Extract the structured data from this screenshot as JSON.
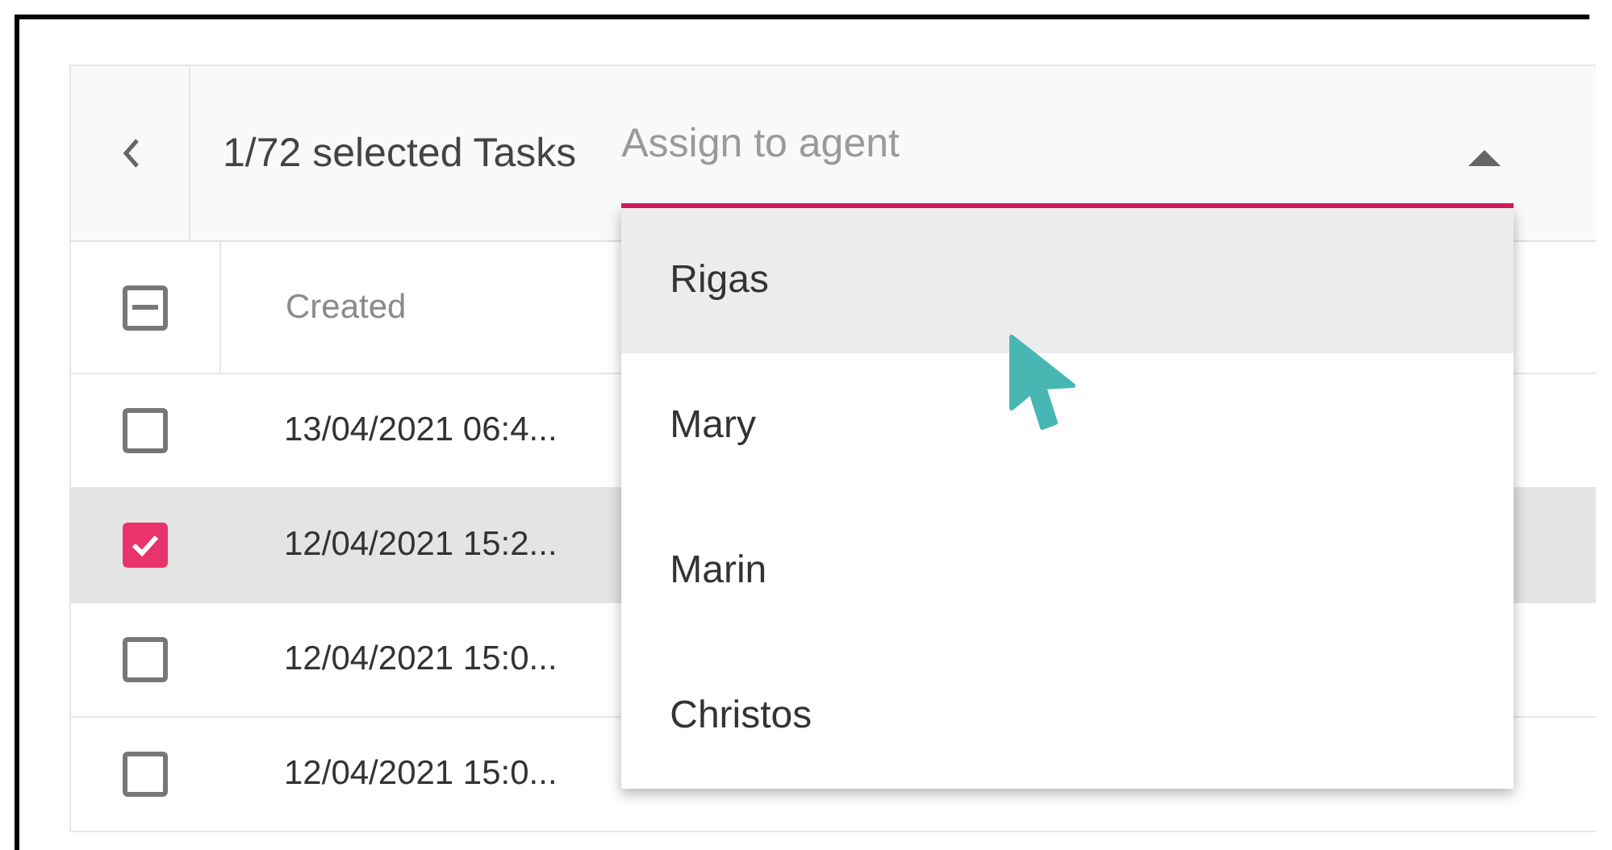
{
  "header": {
    "selection_text": "1/72 selected Tasks",
    "assign_field": {
      "placeholder": "Assign to agent",
      "expanded": true
    }
  },
  "table": {
    "select_all": {
      "indeterminate": true
    },
    "columns": [
      "Created"
    ],
    "rows": [
      {
        "created": "13/04/2021 06:4...",
        "selected": false
      },
      {
        "created": "12/04/2021 15:2...",
        "selected": true
      },
      {
        "created": "12/04/2021 15:0...",
        "selected": false
      },
      {
        "created": "12/04/2021 15:0...",
        "selected": false
      }
    ]
  },
  "dropdown": {
    "options": [
      {
        "label": "Rigas",
        "hovered": true
      },
      {
        "label": "Mary",
        "hovered": false
      },
      {
        "label": "Marin",
        "hovered": false
      },
      {
        "label": "Christos",
        "hovered": false
      }
    ]
  }
}
